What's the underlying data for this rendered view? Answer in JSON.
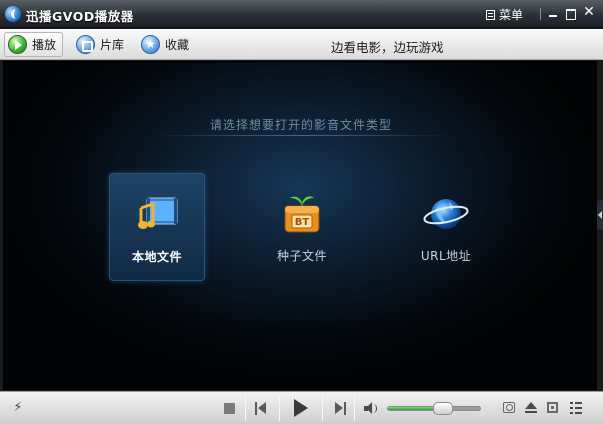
{
  "window": {
    "title": "迅播GVOD播放器",
    "menu_label": "菜单"
  },
  "toolbar": {
    "buttons": [
      {
        "label": "播放",
        "icon": "play-circle-icon",
        "active": true
      },
      {
        "label": "片库",
        "icon": "library-icon",
        "active": false
      },
      {
        "label": "收藏",
        "icon": "star-icon",
        "active": false
      }
    ],
    "slogan": "边看电影，边玩游戏"
  },
  "main": {
    "prompt": "请选择想要打开的影音文件类型",
    "options": [
      {
        "label": "本地文件",
        "icon": "music-film-icon",
        "selected": true
      },
      {
        "label": "种子文件",
        "icon": "bt-box-icon",
        "selected": false
      },
      {
        "label": "URL地址",
        "icon": "globe-icon",
        "selected": false
      }
    ]
  },
  "controls": {
    "volume_level": 0.6
  },
  "colors": {
    "accent_green": "#2f9a2f",
    "bt_orange": "#e8901f",
    "selected_tile": "#1f4366"
  }
}
